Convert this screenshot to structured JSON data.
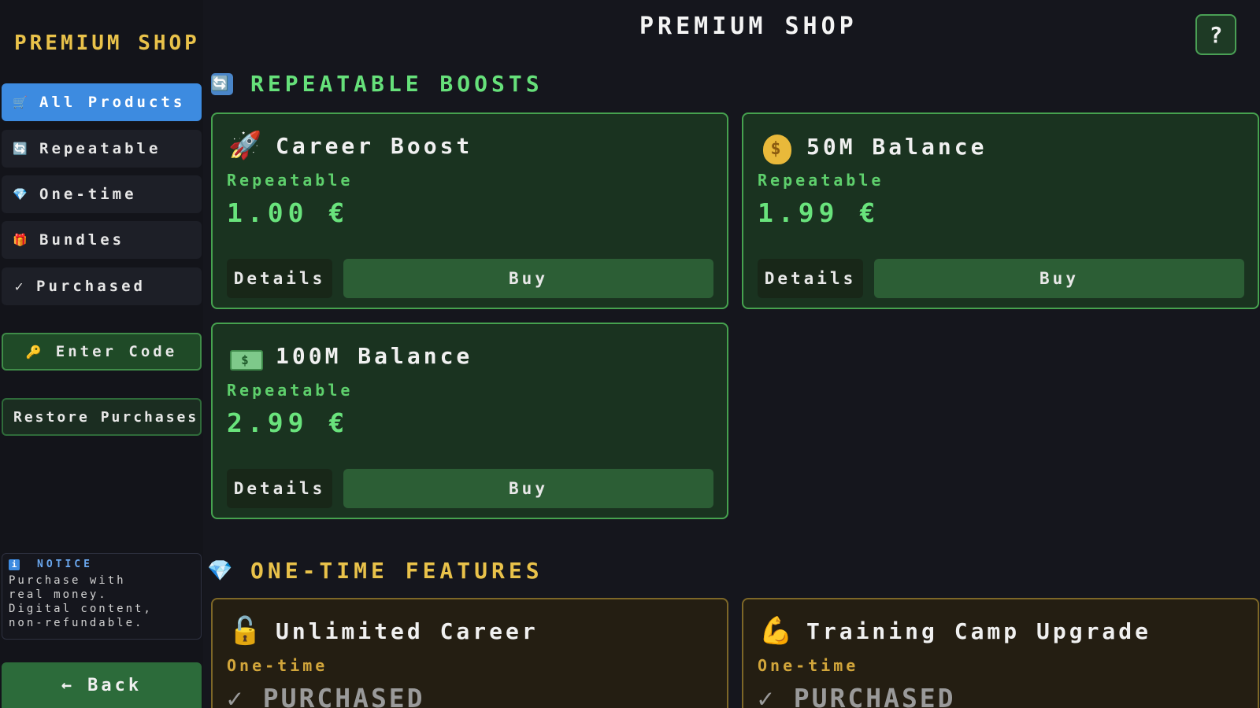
{
  "sidebar": {
    "title": "PREMIUM SHOP",
    "nav": [
      {
        "icon": "cart-icon",
        "glyph": "🛒",
        "label": "All Products",
        "active": true
      },
      {
        "icon": "repeat-icon",
        "glyph": "🔄",
        "label": "Repeatable",
        "active": false
      },
      {
        "icon": "gem-icon",
        "glyph": "💎",
        "label": "One-time",
        "active": false
      },
      {
        "icon": "gift-icon",
        "glyph": "🎁",
        "label": "Bundles",
        "active": false
      },
      {
        "icon": "check-icon",
        "glyph": "✓",
        "label": "Purchased",
        "active": false
      }
    ],
    "enter_code": {
      "icon": "key-icon",
      "glyph": "🔑",
      "label": "Enter Code"
    },
    "restore": {
      "label": "Restore Purchases"
    },
    "notice": {
      "icon": "info-icon",
      "glyph": "i",
      "title": "NOTICE",
      "text": "Purchase with\nreal money.\nDigital content,\nnon-refundable."
    },
    "back": {
      "icon": "arrow-left-icon",
      "glyph": "←",
      "label": "Back"
    }
  },
  "header": {
    "title": "PREMIUM SHOP",
    "help": {
      "icon": "help-icon",
      "glyph": "?"
    }
  },
  "sections": {
    "repeatable": {
      "icon": "repeat-icon",
      "glyph": "🔄",
      "title": "REPEATABLE BOOSTS",
      "items": [
        {
          "icon": "rocket-icon",
          "glyph": "🚀",
          "name": "Career Boost",
          "type": "Repeatable",
          "price": "1.00 €",
          "details_label": "Details",
          "buy_label": "Buy"
        },
        {
          "icon": "money-bag-icon",
          "glyph": "$",
          "name": "50M Balance",
          "type": "Repeatable",
          "price": "1.99 €",
          "details_label": "Details",
          "buy_label": "Buy"
        },
        {
          "icon": "banknote-icon",
          "glyph": "$",
          "name": "100M Balance",
          "type": "Repeatable",
          "price": "2.99 €",
          "details_label": "Details",
          "buy_label": "Buy"
        }
      ]
    },
    "onetime": {
      "icon": "gem-icon",
      "glyph": "💎",
      "title": "ONE-TIME FEATURES",
      "items": [
        {
          "icon": "unlock-icon",
          "glyph": "🔓",
          "name": "Unlimited Career",
          "type": "One-time",
          "status": "✓ PURCHASED"
        },
        {
          "icon": "flexed-arm-icon",
          "glyph": "💪",
          "name": "Training Camp Upgrade",
          "type": "One-time",
          "status": "✓ PURCHASED"
        }
      ]
    }
  },
  "colors": {
    "background": "#15161d",
    "accent_blue": "#3d8be0",
    "green": "#66e07a",
    "gold": "#e9c24a"
  }
}
